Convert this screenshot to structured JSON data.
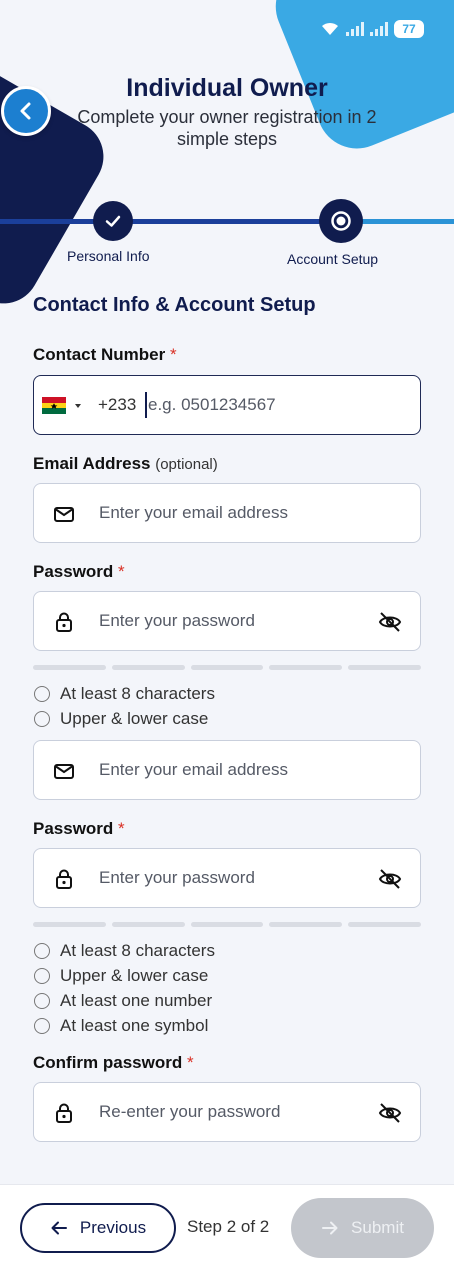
{
  "header": {
    "title": "Individual Owner",
    "subtitle": "Complete your owner registration in 2 simple steps"
  },
  "status_bar": {
    "battery": "77"
  },
  "stepper": {
    "steps": [
      {
        "label": "Personal Info",
        "state": "completed",
        "icon": "check-icon"
      },
      {
        "label": "Account Setup",
        "state": "active",
        "icon": "radio-dot-icon"
      }
    ]
  },
  "form": {
    "section_title": "Contact Info & Account Setup",
    "contact": {
      "label": "Contact Number",
      "required_mark": "*",
      "country_code": "+233",
      "placeholder": "e.g. 0501234567",
      "flag": "ghana-flag-icon"
    },
    "email": {
      "label": "Email Address",
      "optional": "(optional)",
      "placeholder": "Enter your email address"
    },
    "password": {
      "label": "Password",
      "required_mark": "*",
      "placeholder": "Enter your password",
      "rules_short": [
        "At least 8 characters",
        "Upper & lower case"
      ]
    },
    "email_2": {
      "placeholder": "Enter your email address"
    },
    "password_2": {
      "label": "Password",
      "required_mark": "*",
      "placeholder": "Enter your password",
      "rules": [
        "At least 8 characters",
        "Upper & lower case",
        "At least one number",
        "At least one symbol"
      ]
    },
    "confirm": {
      "label": "Confirm password",
      "required_mark": "*",
      "placeholder": "Re-enter your password"
    }
  },
  "footer": {
    "previous": "Previous",
    "step_text": "Step 2 of 2",
    "submit": "Submit"
  },
  "colors": {
    "navy": "#101c4e",
    "accent_blue": "#3aa9e4",
    "required_red": "#d93025",
    "disabled_gray": "#c3c6cc"
  }
}
